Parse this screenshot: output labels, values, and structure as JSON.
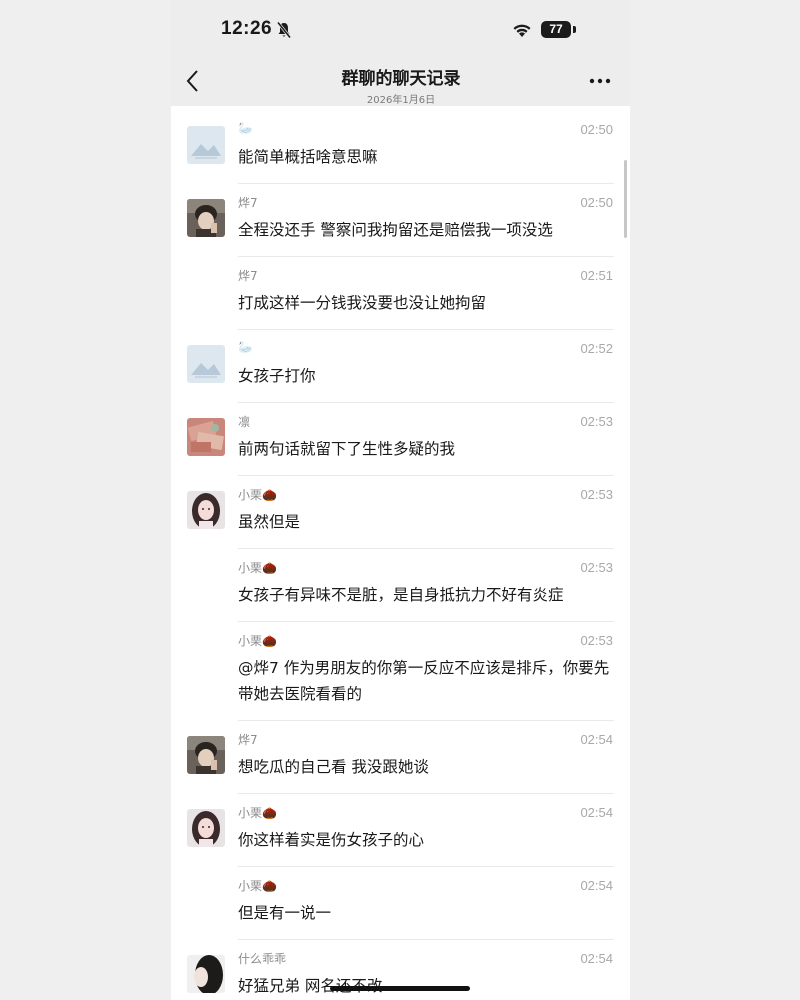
{
  "status_bar": {
    "time": "12:26",
    "battery": "77"
  },
  "header": {
    "title": "群聊的聊天记录",
    "date": "2026年1月6日"
  },
  "messages": [
    {
      "sender": "🦢",
      "time": "02:50",
      "text": "能简单概括啥意思嘛",
      "avatar": "landscape-placeholder"
    },
    {
      "sender": "烨7",
      "time": "02:50",
      "text": "全程没还手 警察问我拘留还是赔偿我一项没选",
      "avatar": "person-photo"
    },
    {
      "sender": "烨7",
      "time": "02:51",
      "text": "打成这样一分钱我没要也没让她拘留",
      "avatar": ""
    },
    {
      "sender": "🦢",
      "time": "02:52",
      "text": "女孩子打你",
      "avatar": "landscape-placeholder"
    },
    {
      "sender": "凛",
      "time": "02:53",
      "text": "前两句话就留下了生性多疑的我",
      "avatar": "cash-photo"
    },
    {
      "sender": "小栗🌰",
      "time": "02:53",
      "text": "虽然但是",
      "avatar": "girl-photo"
    },
    {
      "sender": "小栗🌰",
      "time": "02:53",
      "text": "女孩子有异味不是脏，是自身抵抗力不好有炎症",
      "avatar": ""
    },
    {
      "sender": "小栗🌰",
      "time": "02:53",
      "text": "@烨7 作为男朋友的你第一反应不应该是排斥，你要先带她去医院看看的",
      "avatar": ""
    },
    {
      "sender": "烨7",
      "time": "02:54",
      "text": "想吃瓜的自己看 我没跟她谈",
      "avatar": "person-photo"
    },
    {
      "sender": "小栗🌰",
      "time": "02:54",
      "text": "你这样着实是伤女孩子的心",
      "avatar": "girl-photo"
    },
    {
      "sender": "小栗🌰",
      "time": "02:54",
      "text": "但是有一说一",
      "avatar": ""
    },
    {
      "sender": "什么乖乖",
      "time": "02:54",
      "text": "好猛兄弟 网名还不改",
      "avatar": "dark-hair-photo"
    }
  ]
}
